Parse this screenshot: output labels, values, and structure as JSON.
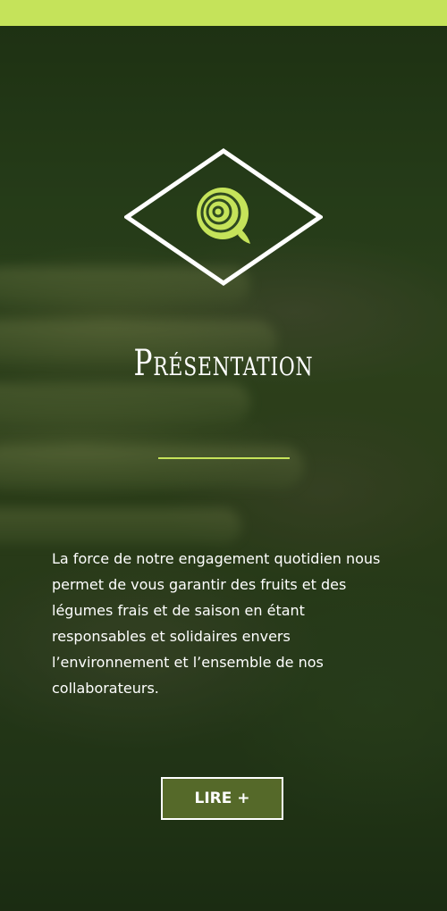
{
  "theme": {
    "accent": "#c5e35a",
    "text": "#ffffff",
    "button_bg": "#5f732d"
  },
  "header": {
    "icon": "onion-icon"
  },
  "section": {
    "title": "Présentation",
    "description": "La force de notre engagement quotidien nous permet de vous garantir des fruits et des légumes frais et de saison en étant responsables et solidaires envers l’environnement et l’ensemble de nos collaborateurs.",
    "button_label": "LIRE +"
  }
}
